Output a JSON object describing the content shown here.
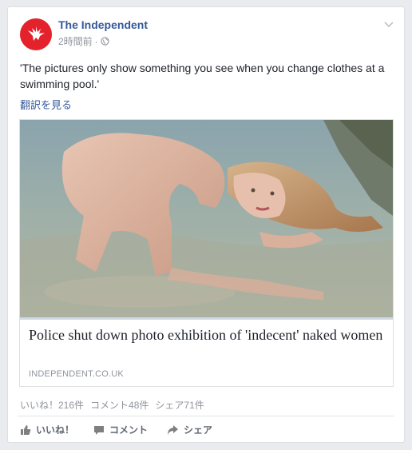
{
  "post": {
    "page_name": "The Independent",
    "time": "2時間前",
    "time_separator": "·",
    "privacy_icon": "globe-icon",
    "text": "'The pictures only show something you see when you change clothes at a swimming pool.'",
    "translate_label": "翻訳を見る"
  },
  "link": {
    "headline": "Police shut down photo exhibition of 'indecent' naked women",
    "domain": "INDEPENDENT.CO.UK"
  },
  "stats": {
    "likes": "いいね！216件",
    "comments": "コメント48件",
    "shares": "シェア71件"
  },
  "actions": {
    "like": "いいね！",
    "comment": "コメント",
    "share": "シェア"
  },
  "colors": {
    "brand_red": "#e4222b",
    "link_blue": "#365899",
    "muted": "#90949c"
  }
}
